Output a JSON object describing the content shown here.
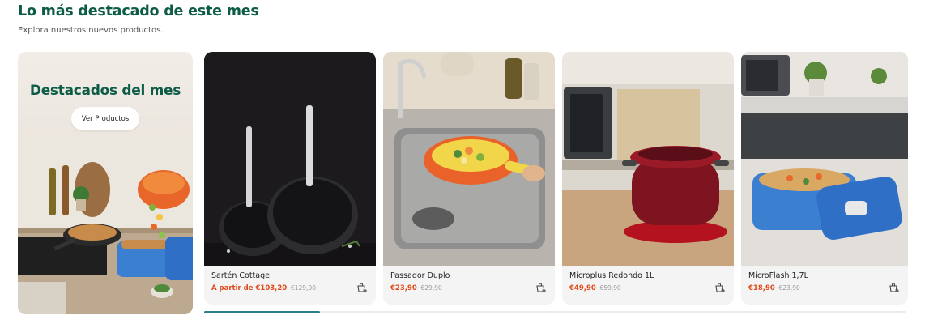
{
  "section": {
    "title": "Lo más destacado de este mes",
    "subtitle": "Explora nuestros nuevos productos."
  },
  "hero": {
    "title": "Destacados del mes",
    "button_label": "Ver Productos"
  },
  "products": [
    {
      "name": "Sartén Cottage",
      "prefix": "A partir de ",
      "price": "€103,20",
      "old_price": "€129,00",
      "icon": "add-to-cart-icon"
    },
    {
      "name": "Passador Duplo",
      "prefix": "",
      "price": "€23,90",
      "old_price": "€29,90",
      "icon": "add-to-cart-icon"
    },
    {
      "name": "Microplus Redondo 1L",
      "prefix": "",
      "price": "€49,90",
      "old_price": "€59,90",
      "icon": "add-to-cart-icon"
    },
    {
      "name": "MicroFlash 1,7L",
      "prefix": "",
      "price": "€18,90",
      "old_price": "€23,90",
      "icon": "add-to-cart-icon"
    }
  ],
  "carousel": {
    "progress": 0.165
  },
  "colors": {
    "brand_green": "#0d5c47",
    "price_orange": "#e04a1a",
    "progress": "#2e7d8c"
  }
}
